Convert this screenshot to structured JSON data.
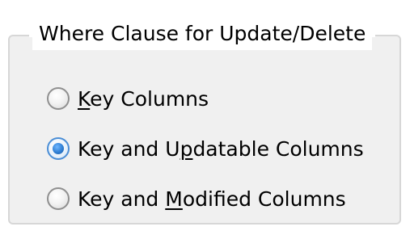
{
  "group": {
    "title": "Where Clause for Update/Delete"
  },
  "options": [
    {
      "pre": "",
      "mnemonic": "K",
      "post": "ey Columns",
      "checked": false
    },
    {
      "pre": "Key and U",
      "mnemonic": "p",
      "post": "datable Columns",
      "checked": true
    },
    {
      "pre": "Key and ",
      "mnemonic": "M",
      "post": "odified Columns",
      "checked": false
    }
  ]
}
